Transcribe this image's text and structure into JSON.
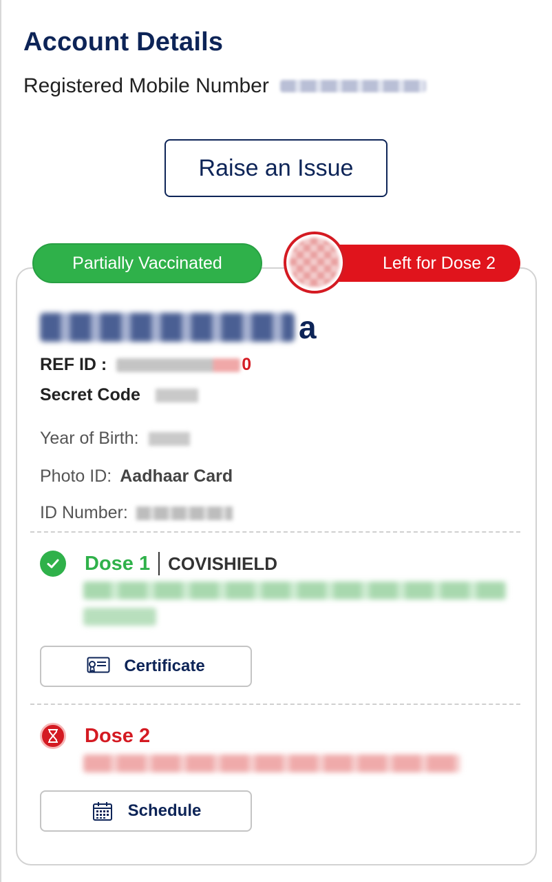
{
  "account": {
    "title": "Account Details",
    "mobile_label": "Registered Mobile Number"
  },
  "raise_issue": {
    "label": "Raise an Issue"
  },
  "beneficiary": {
    "status": "Partially Vaccinated",
    "left_for": "Left for Dose 2",
    "name_visible_tail": "a",
    "ref_label": "REF ID : ",
    "ref_visible_tail": "0",
    "secret_label": "Secret Code",
    "birth_label": "Year of Birth:",
    "photo_label": "Photo ID:",
    "photo_value": "Aadhaar Card",
    "idnum_label": "ID Number:"
  },
  "dose1": {
    "label": "Dose 1",
    "vaccine": "COVISHIELD",
    "button_label": "Certificate",
    "icon": "check-icon",
    "color": "#2fb14a"
  },
  "dose2": {
    "label": "Dose 2",
    "button_label": "Schedule",
    "icon": "hourglass-icon",
    "color": "#d41a22"
  },
  "colors": {
    "navy": "#0d2457",
    "green": "#2fb14a",
    "red": "#e0141c"
  }
}
